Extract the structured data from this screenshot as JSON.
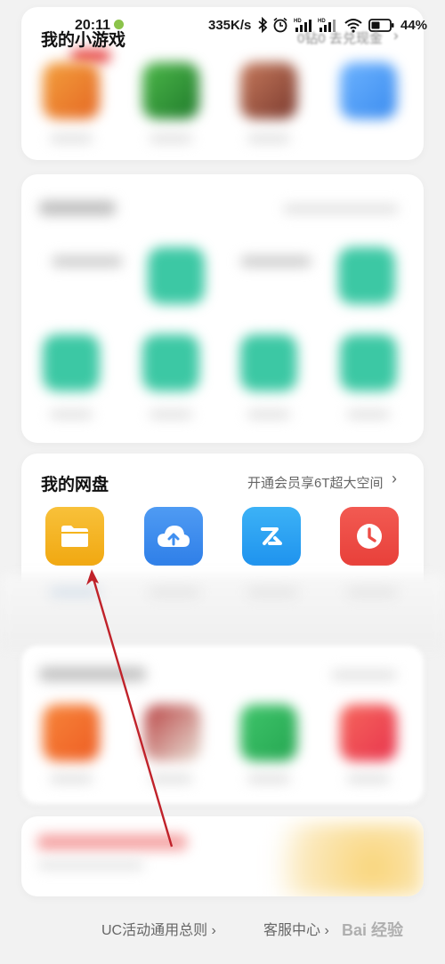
{
  "status_bar": {
    "time": "20:11",
    "net_speed": "335K/s",
    "battery": "44%"
  },
  "games_section": {
    "title": "我的小游戏",
    "link": "0钻0 去兑现金"
  },
  "netdisk_section": {
    "title": "我的网盘",
    "link": "开通会员享6T超大空间",
    "icons": [
      "folder-icon",
      "cloud-upload-icon",
      "transfer-icon",
      "clock-icon"
    ]
  },
  "footer": {
    "rules": "UC活动通用总则 ›",
    "service": "客服中心 ›",
    "watermark": "Bai 经验"
  },
  "colors": {
    "accent_red": "#c0222a",
    "folder": "#f5b41c",
    "cloud": "#3f8ff0",
    "transfer": "#2ea5f3",
    "clock": "#ee4d46"
  }
}
